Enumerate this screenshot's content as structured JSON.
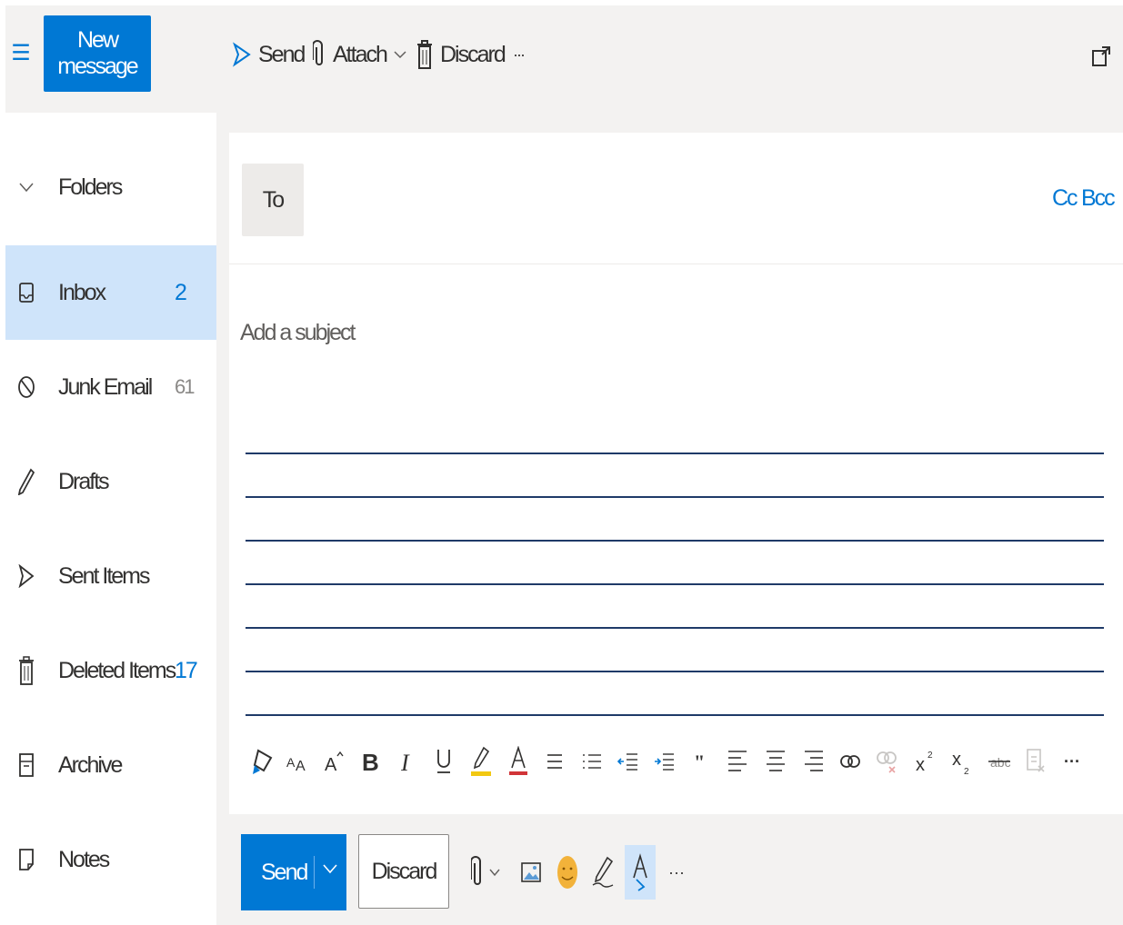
{
  "header": {
    "new_message": "New message",
    "send": "Send",
    "attach": "Attach",
    "discard": "Discard",
    "more": "···",
    "icons": [
      "hamburger-icon",
      "send-icon",
      "paperclip-icon",
      "trash-icon",
      "more-icon",
      "popout-icon"
    ]
  },
  "sidebar": {
    "folders_label": "Folders",
    "items": [
      {
        "label": "Inbox",
        "count": "2",
        "icon": "inbox-icon",
        "selected": true
      },
      {
        "label": "Junk Email",
        "count": "61",
        "icon": "junk-icon"
      },
      {
        "label": "Drafts",
        "count": "",
        "icon": "pencil-icon"
      },
      {
        "label": "Sent Items",
        "count": "",
        "icon": "send-icon"
      },
      {
        "label": "Deleted Items",
        "count": "17",
        "icon": "trash-icon"
      },
      {
        "label": "Archive",
        "count": "",
        "icon": "archive-icon"
      },
      {
        "label": "Notes",
        "count": "",
        "icon": "note-icon"
      }
    ]
  },
  "compose": {
    "to_label": "To",
    "cc_label": "Cc",
    "bcc_label": "Bcc",
    "subject_placeholder": "Add a subject"
  },
  "footer": {
    "send_label": "Send",
    "discard_label": "Discard",
    "more": "···"
  },
  "colors": {
    "accent": "#0078d4",
    "selected_bg": "#cfe4fa",
    "toolbar_bg": "#f3f2f1",
    "rule": "#1f3a68",
    "highlight_yellow": "#f2c811",
    "font_red": "#d13438"
  }
}
